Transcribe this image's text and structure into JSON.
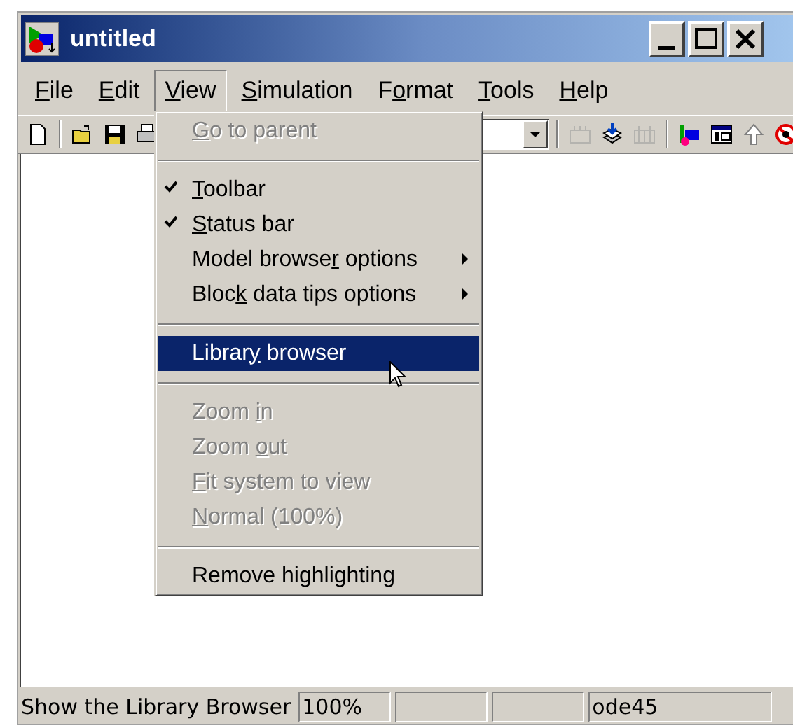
{
  "window": {
    "title": "untitled"
  },
  "menu_bar": [
    {
      "label": {
        "key": "F",
        "after": "ile"
      },
      "selected": false
    },
    {
      "label": {
        "key": "E",
        "after": "dit"
      },
      "selected": false
    },
    {
      "label": {
        "key": "V",
        "after": "iew"
      },
      "selected": true
    },
    {
      "label": {
        "key": "S",
        "after": "imulation"
      },
      "selected": false
    },
    {
      "label": {
        "before": "F",
        "key": "o",
        "after": "rmat"
      },
      "selected": false
    },
    {
      "label": {
        "key": "T",
        "after": "ools"
      },
      "selected": false
    },
    {
      "label": {
        "key": "H",
        "after": "elp"
      },
      "selected": false
    }
  ],
  "toolbar": [
    {
      "kind": "new",
      "disabled": false
    },
    {
      "kind": "separator"
    },
    {
      "kind": "open",
      "disabled": false
    },
    {
      "kind": "save",
      "disabled": false
    },
    {
      "kind": "print",
      "disabled": false
    },
    {
      "kind": "combo"
    },
    {
      "kind": "separator"
    },
    {
      "kind": "library",
      "disabled": true
    },
    {
      "kind": "load",
      "disabled": false
    },
    {
      "kind": "grid",
      "disabled": true
    },
    {
      "kind": "separator"
    },
    {
      "kind": "block",
      "disabled": false
    },
    {
      "kind": "explorer",
      "disabled": false
    },
    {
      "kind": "up",
      "disabled": false
    },
    {
      "kind": "debug",
      "disabled": false
    }
  ],
  "view_menu": [
    {
      "kind": "item",
      "label": {
        "key": "G",
        "after": "o to parent"
      },
      "checked": false,
      "disabled": true,
      "submenu": false,
      "selected": false
    },
    {
      "kind": "separator"
    },
    {
      "kind": "item",
      "label": {
        "key": "T",
        "after": "oolbar"
      },
      "checked": true,
      "disabled": false,
      "submenu": false,
      "selected": false
    },
    {
      "kind": "item",
      "label": {
        "key": "S",
        "after": "tatus bar"
      },
      "checked": true,
      "disabled": false,
      "submenu": false,
      "selected": false
    },
    {
      "kind": "item",
      "label": {
        "before": "Model browse",
        "key": "r",
        "after": " options"
      },
      "checked": false,
      "disabled": false,
      "submenu": true,
      "selected": false
    },
    {
      "kind": "item",
      "label": {
        "before": "Bloc",
        "key": "k",
        "after": " data tips options"
      },
      "checked": false,
      "disabled": false,
      "submenu": true,
      "selected": false
    },
    {
      "kind": "separator"
    },
    {
      "kind": "item",
      "label": {
        "before": "Librar",
        "key": "y",
        "after": " browser"
      },
      "checked": false,
      "disabled": false,
      "submenu": false,
      "selected": true
    },
    {
      "kind": "separator"
    },
    {
      "kind": "item",
      "label": {
        "before": "Zoom ",
        "key": "i",
        "after": "n"
      },
      "checked": false,
      "disabled": true,
      "submenu": false,
      "selected": false
    },
    {
      "kind": "item",
      "label": {
        "before": "Zoom ",
        "key": "o",
        "after": "ut"
      },
      "checked": false,
      "disabled": true,
      "submenu": false,
      "selected": false
    },
    {
      "kind": "item",
      "label": {
        "key": "F",
        "after": "it system to view"
      },
      "checked": false,
      "disabled": true,
      "submenu": false,
      "selected": false
    },
    {
      "kind": "item",
      "label": {
        "key": "N",
        "after": "ormal (100%)"
      },
      "checked": false,
      "disabled": true,
      "submenu": false,
      "selected": false
    },
    {
      "kind": "separator"
    },
    {
      "kind": "item",
      "label": {
        "before": "Remove highlighting"
      },
      "checked": false,
      "disabled": false,
      "submenu": false,
      "selected": false
    }
  ],
  "status_bar": [
    {
      "kind": "message",
      "text": "Show the Library Browser"
    },
    {
      "kind": "pane",
      "text": "100%"
    },
    {
      "kind": "pane"
    },
    {
      "kind": "pane"
    },
    {
      "kind": "pane",
      "text": "ode45"
    }
  ]
}
